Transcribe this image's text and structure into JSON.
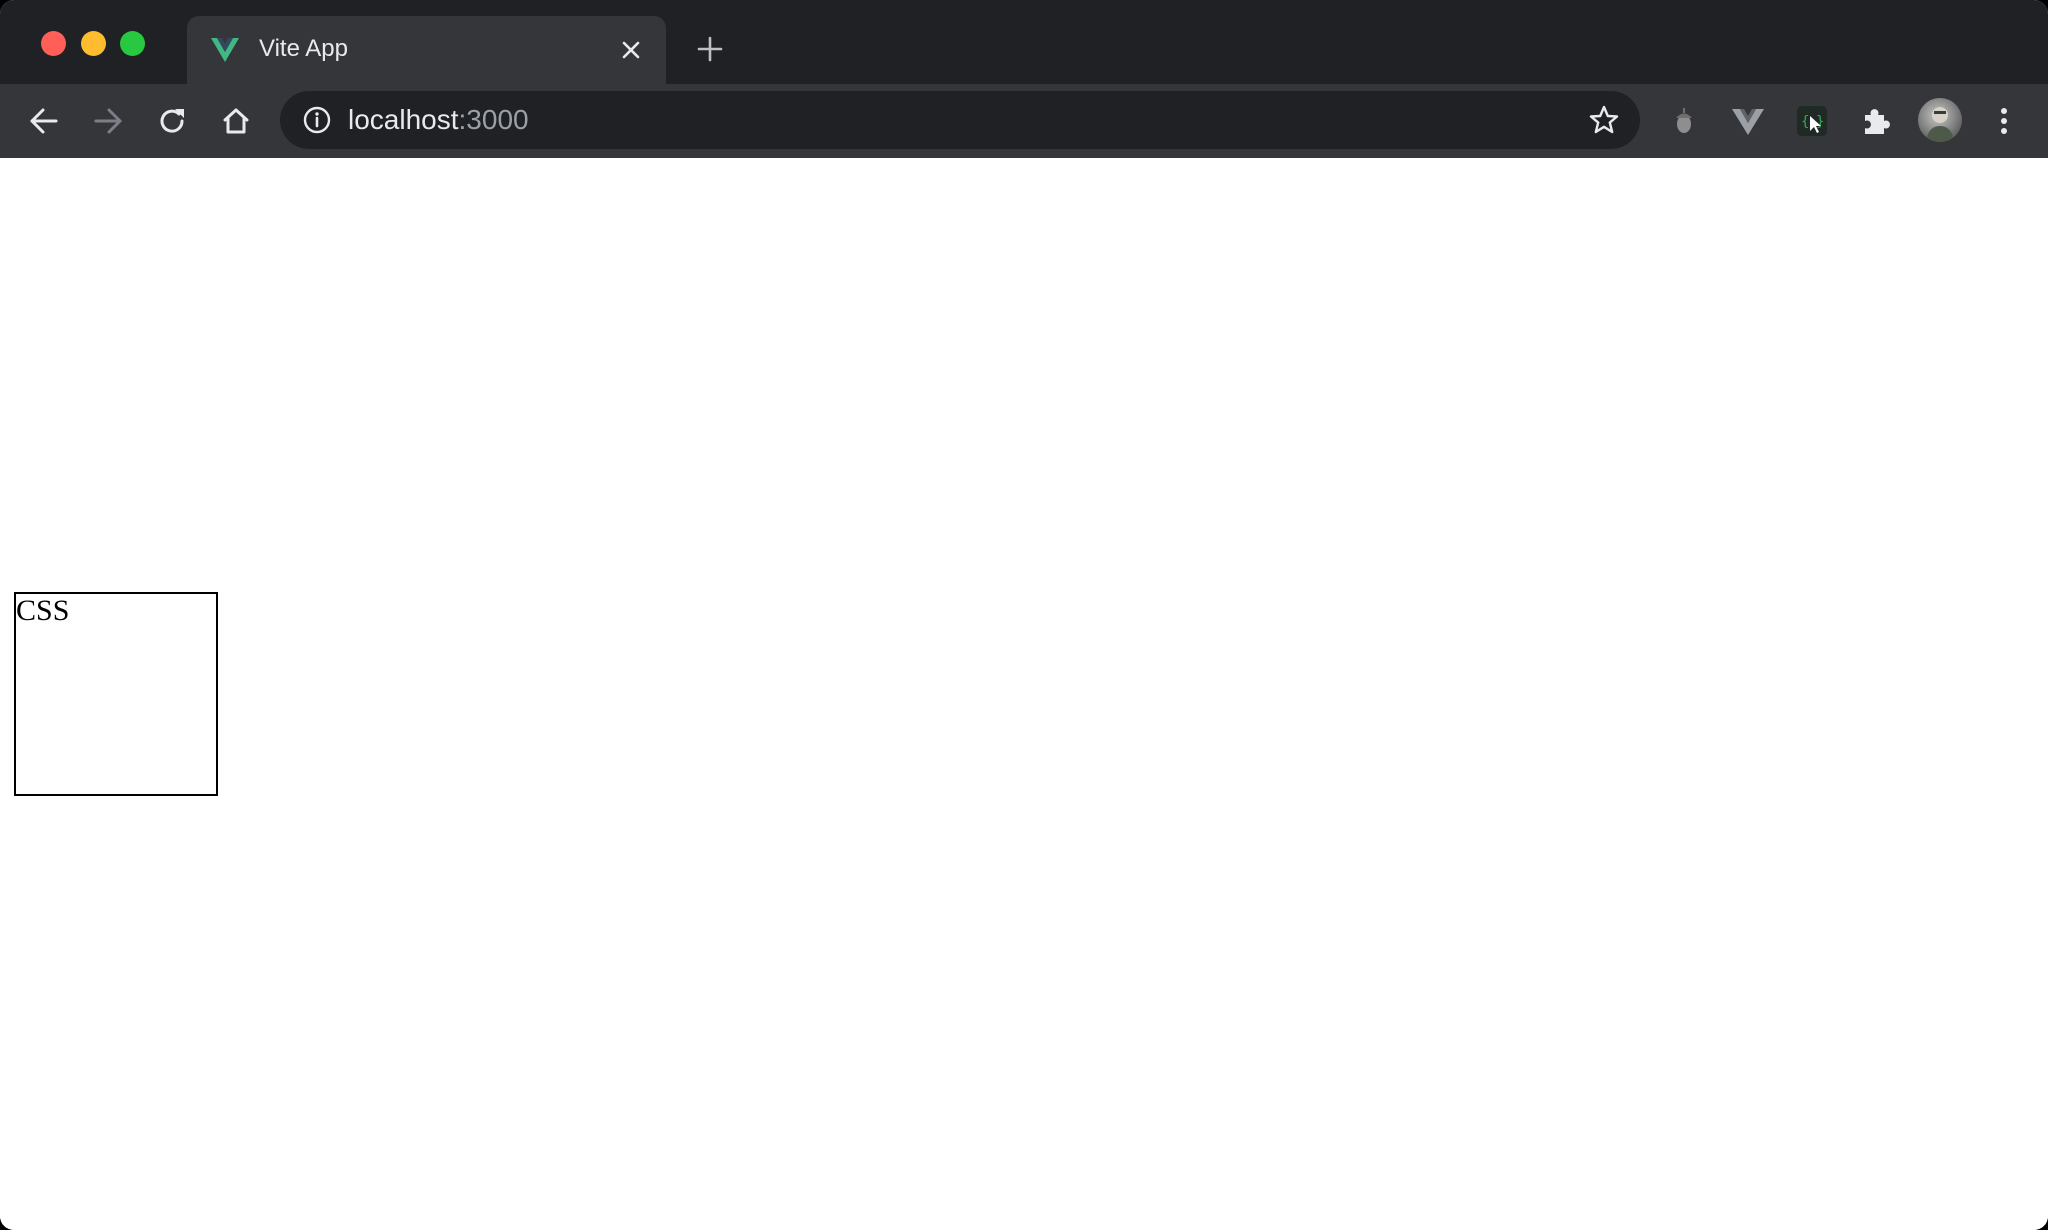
{
  "browser": {
    "window_controls": {
      "close_color": "#ff5f57",
      "minimize_color": "#febc2e",
      "maximize_color": "#28c840"
    },
    "tab": {
      "title": "Vite App",
      "favicon": "vue-logo-icon",
      "favicon_color": "#41b883"
    },
    "address_bar": {
      "host": "localhost",
      "port": ":3000"
    },
    "extensions": [
      "acorn-extension-icon",
      "vue-devtools-icon",
      "selector-extension-icon",
      "puzzle-icon"
    ]
  },
  "page": {
    "box_text": "CSS"
  }
}
